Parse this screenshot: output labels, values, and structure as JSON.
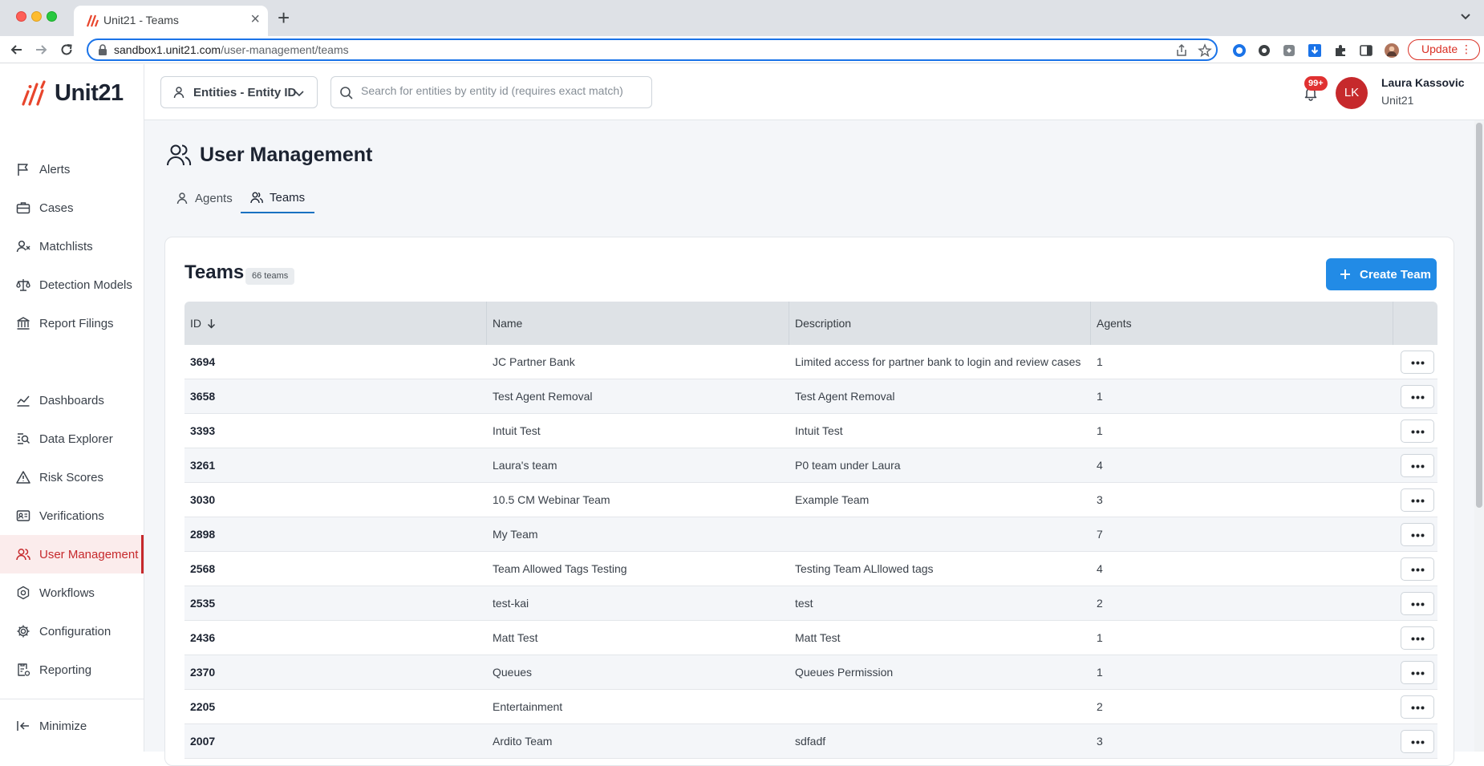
{
  "browser": {
    "tab_title": "Unit21 - Teams",
    "url_host": "sandbox1.unit21.com",
    "url_path": "/user-management/teams",
    "update_label": "Update"
  },
  "app": {
    "logo_text": "Unit21",
    "entity_select": "Entities - Entity ID",
    "search_placeholder": "Search for entities by entity id (requires exact match)",
    "notification_count": "99+",
    "user": {
      "initials": "LK",
      "name": "Laura Kassovic",
      "org": "Unit21"
    }
  },
  "sidebar": {
    "items": [
      {
        "label": "Alerts",
        "icon": "flag-icon"
      },
      {
        "label": "Cases",
        "icon": "briefcase-icon"
      },
      {
        "label": "Matchlists",
        "icon": "user-x-icon"
      },
      {
        "label": "Detection Models",
        "icon": "scale-icon"
      },
      {
        "label": "Report Filings",
        "icon": "bank-icon"
      },
      {
        "label": "Dashboards",
        "icon": "chart-line-icon"
      },
      {
        "label": "Data Explorer",
        "icon": "data-search-icon"
      },
      {
        "label": "Risk Scores",
        "icon": "warning-icon"
      },
      {
        "label": "Verifications",
        "icon": "id-card-icon"
      },
      {
        "label": "User Management",
        "icon": "users-icon"
      },
      {
        "label": "Workflows",
        "icon": "workflow-icon"
      },
      {
        "label": "Configuration",
        "icon": "gear-icon"
      },
      {
        "label": "Reporting",
        "icon": "report-icon"
      }
    ],
    "minimize_label": "Minimize"
  },
  "page": {
    "title": "User Management",
    "tabs": [
      {
        "label": "Agents"
      },
      {
        "label": "Teams"
      }
    ]
  },
  "teams": {
    "title": "Teams",
    "count_label": "66 teams",
    "create_label": "Create Team",
    "columns": [
      "ID",
      "Name",
      "Description",
      "Agents"
    ],
    "rows": [
      {
        "id": "3694",
        "name": "JC Partner Bank",
        "description": "Limited access for partner bank to login and review cases",
        "agents": "1"
      },
      {
        "id": "3658",
        "name": "Test Agent Removal",
        "description": "Test Agent Removal",
        "agents": "1"
      },
      {
        "id": "3393",
        "name": "Intuit Test",
        "description": "Intuit Test",
        "agents": "1"
      },
      {
        "id": "3261",
        "name": "Laura's team",
        "description": "P0 team under Laura",
        "agents": "4"
      },
      {
        "id": "3030",
        "name": "10.5 CM Webinar Team",
        "description": "Example Team",
        "agents": "3"
      },
      {
        "id": "2898",
        "name": "My Team",
        "description": "",
        "agents": "7"
      },
      {
        "id": "2568",
        "name": "Team Allowed Tags Testing",
        "description": "Testing Team ALllowed tags",
        "agents": "4"
      },
      {
        "id": "2535",
        "name": "test-kai",
        "description": "test",
        "agents": "2"
      },
      {
        "id": "2436",
        "name": "Matt Test",
        "description": "Matt Test",
        "agents": "1"
      },
      {
        "id": "2370",
        "name": "Queues",
        "description": "Queues Permission",
        "agents": "1"
      },
      {
        "id": "2205",
        "name": "Entertainment",
        "description": "",
        "agents": "2"
      },
      {
        "id": "2007",
        "name": "Ardito Team",
        "description": "sdfadf",
        "agents": "3"
      }
    ]
  }
}
